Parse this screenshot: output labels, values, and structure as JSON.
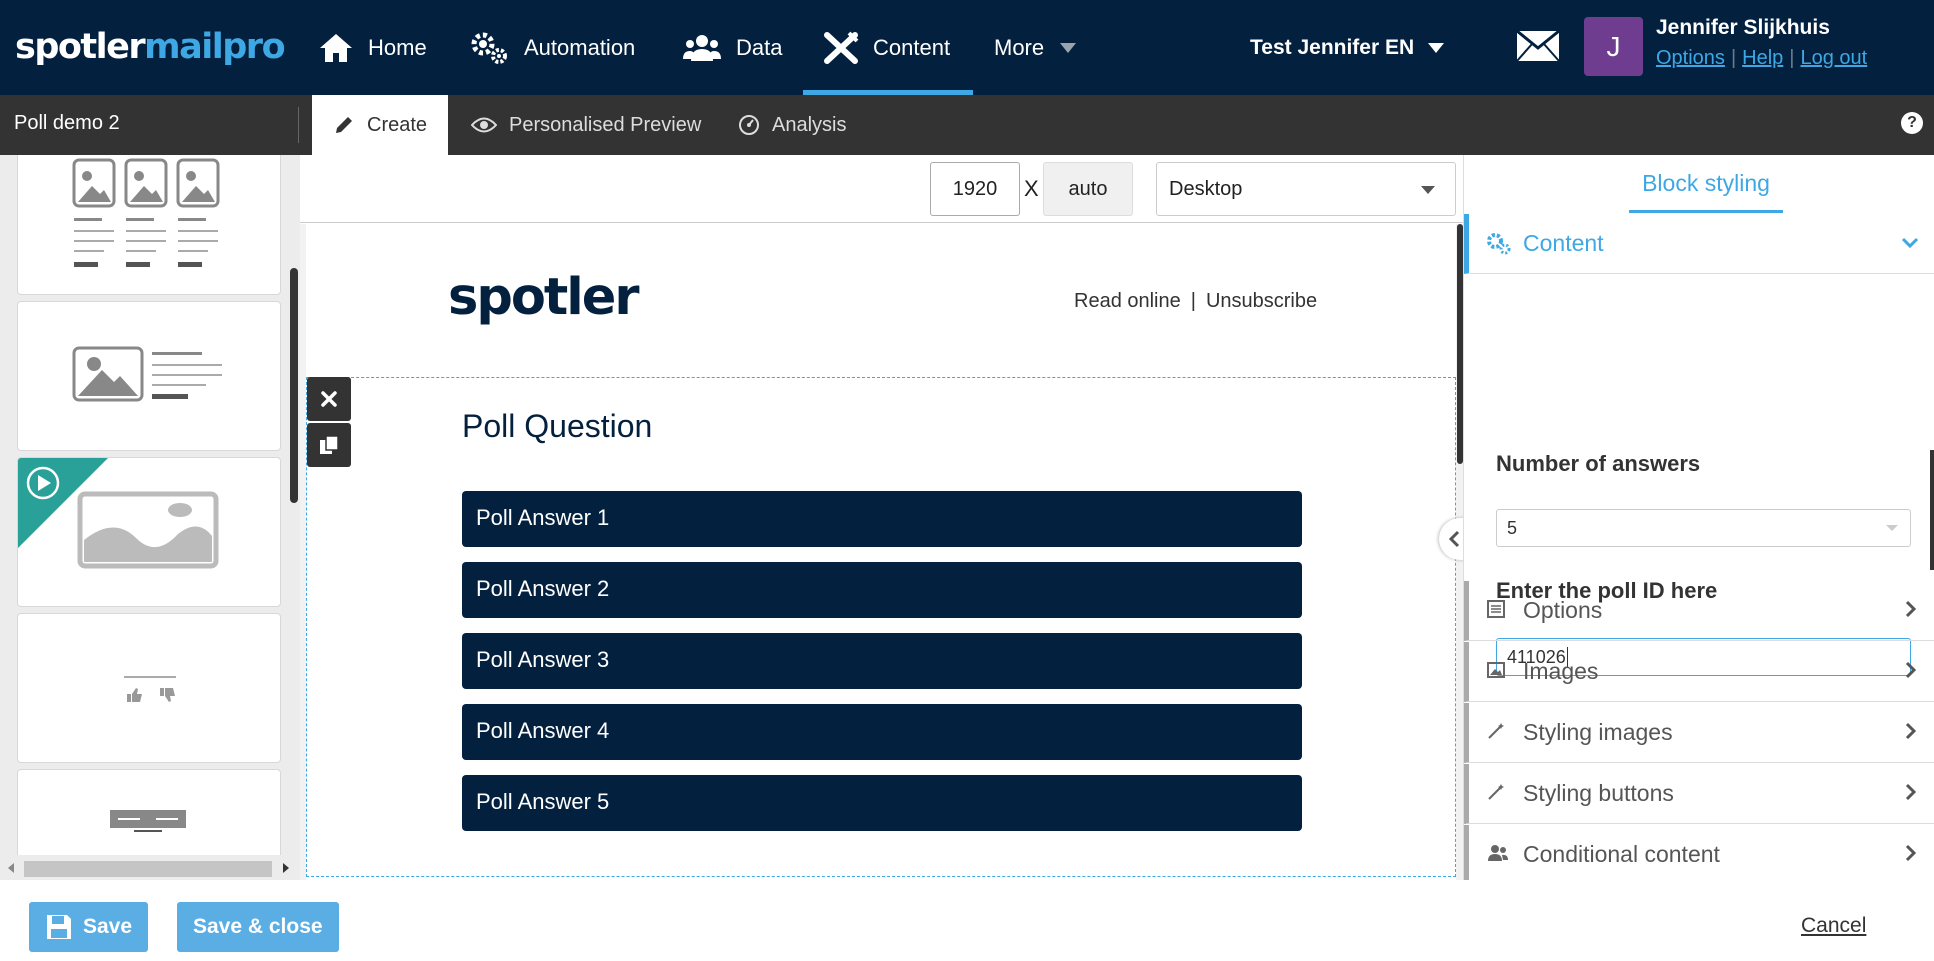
{
  "brand": {
    "part1": "spotler",
    "part2": "mailpro"
  },
  "nav": {
    "items": [
      {
        "label": "Home",
        "icon": "home-icon"
      },
      {
        "label": "Automation",
        "icon": "gears-icon"
      },
      {
        "label": "Data",
        "icon": "users-icon"
      },
      {
        "label": "Content",
        "icon": "pencil-ruler-icon"
      },
      {
        "label": "More",
        "icon": "caret-down-icon"
      }
    ],
    "active": "Content"
  },
  "account": {
    "name": "Test Jennifer EN"
  },
  "user": {
    "avatar_letter": "J",
    "name": "Jennifer Slijkhuis",
    "links": [
      "Options",
      "Help",
      "Log out"
    ]
  },
  "editor": {
    "doc_title": "Poll demo 2",
    "tabs": [
      "Create",
      "Personalised Preview",
      "Analysis"
    ],
    "active_tab": "Create",
    "help": "?"
  },
  "canvas": {
    "width_value": "1920",
    "x_label": "X",
    "height_value": "auto",
    "device": "Desktop"
  },
  "email": {
    "logo": "spotler",
    "read_online": "Read online",
    "separator": "|",
    "unsubscribe": "Unsubscribe",
    "poll_question": "Poll Question",
    "answers": [
      "Poll Answer 1",
      "Poll Answer 2",
      "Poll Answer 3",
      "Poll Answer 4",
      "Poll Answer 5"
    ]
  },
  "panel": {
    "tab": "Block styling",
    "content_section": "Content",
    "number_of_answers_label": "Number of answers",
    "number_of_answers_value": "5",
    "poll_id_label": "Enter the poll ID here",
    "poll_id_value": "411026",
    "sections": [
      "Options",
      "Images",
      "Styling images",
      "Styling buttons",
      "Conditional content"
    ]
  },
  "footer": {
    "save": "Save",
    "save_close": "Save & close",
    "cancel": "Cancel"
  },
  "colors": {
    "navy": "#03203e",
    "accent_blue": "#3ea8e4",
    "button_blue": "#5aaee4",
    "avatar_purple": "#6f3d8f",
    "teal_badge": "#2aa198"
  }
}
